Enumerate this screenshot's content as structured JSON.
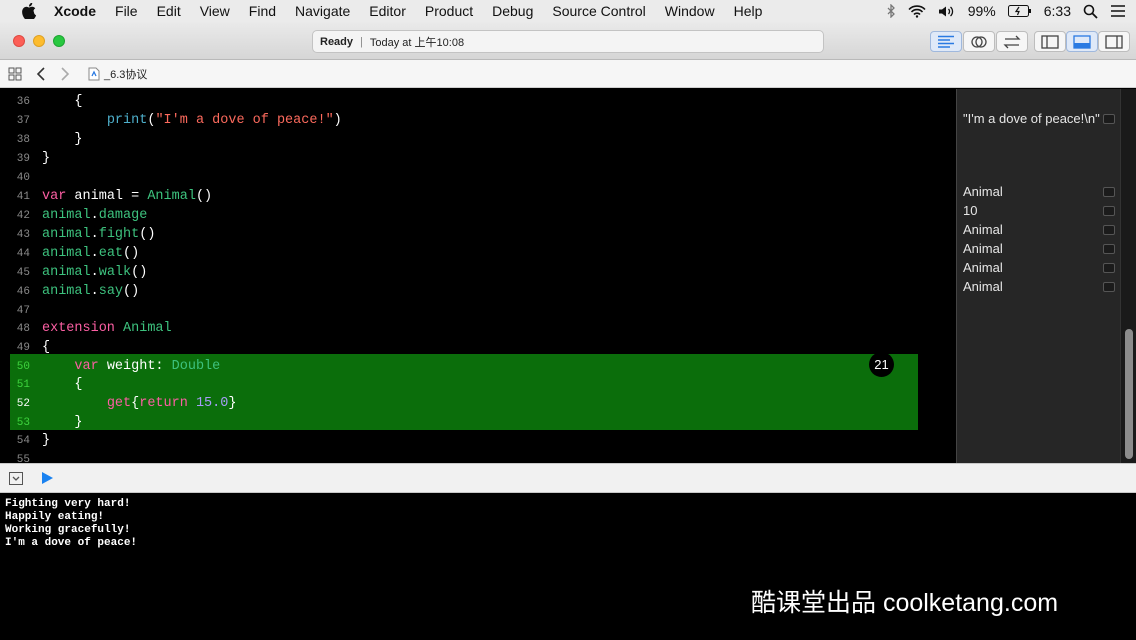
{
  "menubar": {
    "items": [
      "Xcode",
      "File",
      "Edit",
      "View",
      "Find",
      "Navigate",
      "Editor",
      "Product",
      "Debug",
      "Source Control",
      "Window",
      "Help"
    ],
    "battery": "99%",
    "time": "6:33"
  },
  "toolbar": {
    "status_state": "Ready",
    "status_time": "Today at 上午10:08"
  },
  "jumpbar": {
    "file": "_6.3协议"
  },
  "editor": {
    "line_numbers": [
      "36",
      "37",
      "38",
      "39",
      "40",
      "41",
      "42",
      "43",
      "44",
      "45",
      "46",
      "47",
      "48",
      "49",
      "50",
      "51",
      "52",
      "53",
      "54",
      "55"
    ],
    "badge": "21"
  },
  "results": {
    "r37": "\"I'm a dove of peace!\\n\"",
    "r41": "Animal",
    "r42": "10",
    "r43": "Animal",
    "r44": "Animal",
    "r45": "Animal",
    "r46": "Animal"
  },
  "console": {
    "lines": [
      "Fighting very hard!",
      "Happily eating!",
      "Working gracefully!",
      "I'm a dove of peace!"
    ]
  },
  "watermark": "酷课堂出品 coolketang.com",
  "colors": {
    "keyword": "#fc5fa3",
    "type": "#3dc27e",
    "string": "#fc6a5d",
    "highlight": "#0b6e0b"
  }
}
